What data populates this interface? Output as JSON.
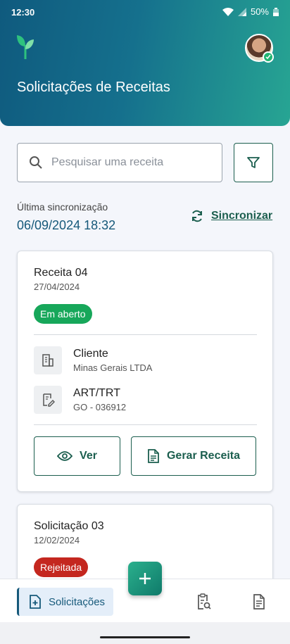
{
  "status_bar": {
    "time": "12:30",
    "battery": "50%"
  },
  "header": {
    "title": "Solicitações de Receitas"
  },
  "search": {
    "placeholder": "Pesquisar uma receita"
  },
  "sync": {
    "label": "Última sincronização",
    "datetime": "06/09/2024 18:32",
    "action": "Sincronizar"
  },
  "cards": [
    {
      "title": "Receita 04",
      "date": "27/04/2024",
      "status": "Em aberto",
      "client_label": "Cliente",
      "client_value": "Minas Gerais LTDA",
      "art_label": "ART/TRT",
      "art_value": "GO - 036912",
      "view_label": "Ver",
      "generate_label": "Gerar Receita"
    },
    {
      "title": "Solicitação 03",
      "date": "12/02/2024",
      "status": "Rejeitada"
    }
  ],
  "bottom_nav": {
    "active_label": "Solicitações"
  },
  "colors": {
    "primary": "#16597a",
    "accent": "#1b5e4e",
    "open": "#17a75a",
    "rejected": "#c4271f"
  }
}
